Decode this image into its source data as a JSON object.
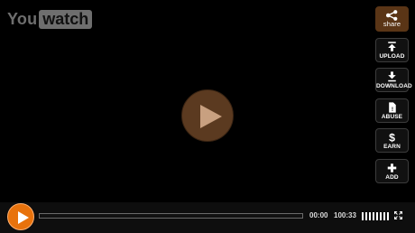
{
  "logo": {
    "part1": "You",
    "part2": "watch"
  },
  "side_buttons": [
    {
      "label": "share",
      "icon": "share-icon"
    },
    {
      "label": "UPLOAD",
      "icon": "upload-icon"
    },
    {
      "label": "DOWNLOAD",
      "icon": "download-icon"
    },
    {
      "label": "ABUSE",
      "icon": "flag-icon"
    },
    {
      "label": "EARN",
      "icon": "dollar-icon"
    },
    {
      "label": "ADD",
      "icon": "plus-icon"
    }
  ],
  "controls": {
    "current_time": "00:00",
    "duration": "100:33",
    "progress_fraction": 0
  },
  "colors": {
    "accent_orange": "#e8720c",
    "share_bg": "#5a3516",
    "center_play_bg": "#5b3a20"
  }
}
